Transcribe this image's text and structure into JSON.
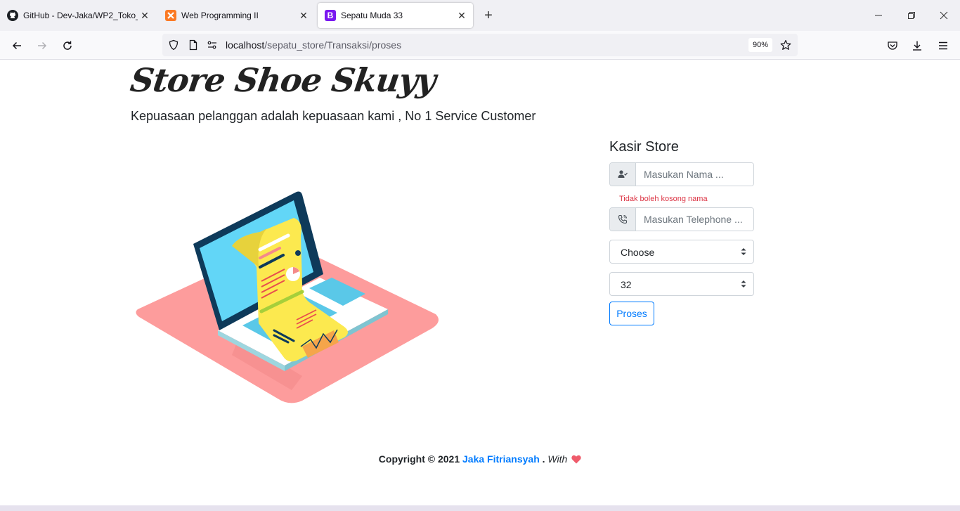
{
  "browser": {
    "tabs": [
      {
        "title": "GitHub - Dev-Jaka/WP2_Toko_s",
        "icon": "github-icon"
      },
      {
        "title": "Web Programming II",
        "icon": "xampp-icon"
      },
      {
        "title": "Sepatu Muda 33",
        "icon": "bootstrap-icon",
        "active": true
      }
    ],
    "url_host": "localhost",
    "url_path": "/sepatu_store/Transaksi/proses",
    "zoom": "90%"
  },
  "page": {
    "brand": "Store Shoe Skuyy",
    "tagline": "Kepuasaan pelanggan adalah kepuasaan kami , No 1 Service Customer"
  },
  "form": {
    "title": "Kasir Store",
    "name_placeholder": "Masukan Nama ...",
    "name_error": "Tidak boleh kosong nama",
    "phone_placeholder": "Masukan Telephone ...",
    "select1_value": "Choose",
    "select2_value": "32",
    "submit_label": "Proses"
  },
  "footer": {
    "copyright": "Copyright © 2021",
    "author": "Jaka Fitriansyah",
    "dot": ".",
    "with": "With"
  },
  "colors": {
    "accent": "#007bff",
    "error": "#dc3545",
    "heart": "#ef5b6b"
  }
}
